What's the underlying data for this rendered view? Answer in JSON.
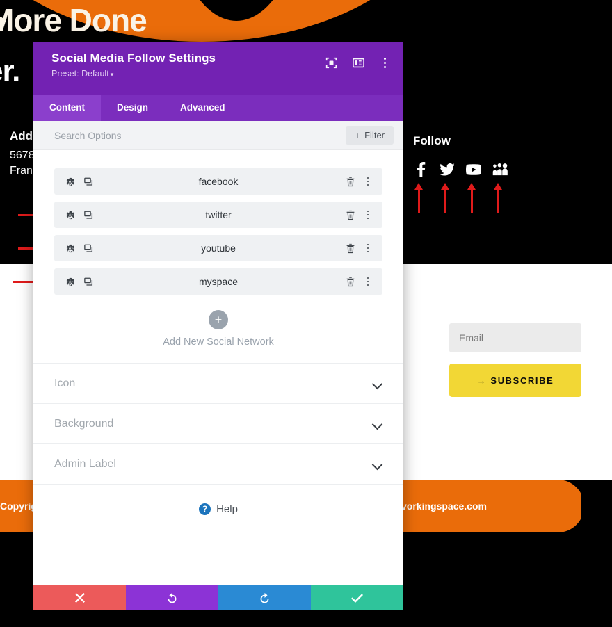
{
  "background": {
    "hero_heading": "More Done",
    "hero_heading_accent": "More Done",
    "hero_sub": "er.",
    "address": {
      "title": "Addr",
      "line1": "5678",
      "line2": "Fran"
    },
    "follow": {
      "title": "Follow",
      "icons": [
        "facebook-icon",
        "twitter-icon",
        "youtube-icon",
        "myspace-icon"
      ]
    },
    "newsletter": {
      "email_placeholder": "Email",
      "email_value": "",
      "subscribe_label": "→ SUBSCRIBE"
    },
    "footer": {
      "left_text": "Copyrig",
      "right_text": "vorkingspace.com"
    },
    "colors": {
      "orange": "#ea6c0a",
      "black": "#000000",
      "yellow": "#f2d735",
      "cream": "#faf3e6"
    }
  },
  "annotation": {
    "arrow_color": "#e01b1b",
    "row_arrow_count": 4,
    "icon_arrow_count": 4
  },
  "modal": {
    "title": "Social Media Follow Settings",
    "preset_label": "Preset: Default",
    "preset_caret": "▾",
    "header_icons": [
      {
        "name": "focus-icon"
      },
      {
        "name": "layout-panel-icon"
      },
      {
        "name": "kebab-menu-icon"
      }
    ],
    "tabs": [
      {
        "label": "Content",
        "active": true
      },
      {
        "label": "Design",
        "active": false
      },
      {
        "label": "Advanced",
        "active": false
      }
    ],
    "search": {
      "placeholder": "Search Options",
      "value": ""
    },
    "filter": {
      "label": "Filter",
      "plus": "+"
    },
    "networks": [
      {
        "name": "facebook"
      },
      {
        "name": "twitter"
      },
      {
        "name": "youtube"
      },
      {
        "name": "myspace"
      }
    ],
    "add_network": {
      "plus": "+",
      "label": "Add New Social Network"
    },
    "accordions": [
      {
        "label": "Icon"
      },
      {
        "label": "Background"
      },
      {
        "label": "Admin Label"
      }
    ],
    "help": {
      "badge": "?",
      "label": "Help"
    },
    "actions": [
      {
        "name": "cancel-button",
        "icon": "close-icon",
        "color": "#ec5a5a"
      },
      {
        "name": "undo-button",
        "icon": "undo-icon",
        "color": "#8c33d6"
      },
      {
        "name": "redo-button",
        "icon": "redo-icon",
        "color": "#2a8ad4"
      },
      {
        "name": "save-button",
        "icon": "check-icon",
        "color": "#2fc49b"
      }
    ],
    "colors": {
      "header_purple": "#7322b3",
      "tabbar_purple": "#7b2dbd",
      "tab_active_purple": "#8b3fcc",
      "row_bg": "#eff1f3"
    }
  }
}
